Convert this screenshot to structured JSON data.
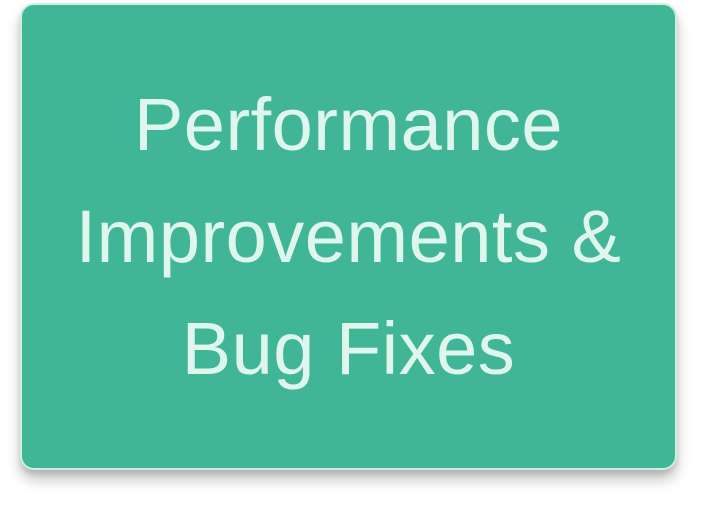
{
  "card": {
    "title": "Performance\nImprovements &\nBug Fixes",
    "background_color": "#41b697",
    "text_color": "#dff6ee"
  }
}
